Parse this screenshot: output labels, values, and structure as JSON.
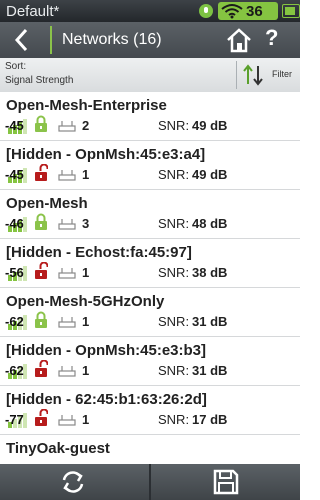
{
  "status": {
    "title": "Default*",
    "signal_value": "36"
  },
  "header": {
    "title": "Networks (16)"
  },
  "sort": {
    "label": "Sort:",
    "value": "Signal Strength",
    "filter_label": "Filter"
  },
  "snr_label": "SNR:",
  "networks": [
    {
      "ssid": "Open-Mesh-Enterprise",
      "rssi": "-45",
      "rssi_level": 0.75,
      "locked": true,
      "bssid_count": "2",
      "snr": "49 dB"
    },
    {
      "ssid": "[Hidden - OpnMsh:45:e3:a4]",
      "rssi": "-45",
      "rssi_level": 0.75,
      "locked": false,
      "bssid_count": "1",
      "snr": "49 dB"
    },
    {
      "ssid": "Open-Mesh",
      "rssi": "-46",
      "rssi_level": 0.75,
      "locked": true,
      "bssid_count": "3",
      "snr": "48 dB"
    },
    {
      "ssid": "[Hidden - Echost:fa:45:97]",
      "rssi": "-56",
      "rssi_level": 0.5,
      "locked": false,
      "bssid_count": "1",
      "snr": "38 dB"
    },
    {
      "ssid": "Open-Mesh-5GHzOnly",
      "rssi": "-62",
      "rssi_level": 0.5,
      "locked": true,
      "bssid_count": "1",
      "snr": "31 dB"
    },
    {
      "ssid": "[Hidden - OpnMsh:45:e3:b3]",
      "rssi": "-62",
      "rssi_level": 0.5,
      "locked": false,
      "bssid_count": "1",
      "snr": "31 dB"
    },
    {
      "ssid": "[Hidden - 62:45:b1:63:26:2d]",
      "rssi": "-77",
      "rssi_level": 0.25,
      "locked": false,
      "bssid_count": "1",
      "snr": "17 dB"
    },
    {
      "ssid": "TinyOak-guest",
      "rssi": "",
      "rssi_level": 0,
      "locked": true,
      "bssid_count": "",
      "snr": ""
    }
  ],
  "colors": {
    "accent_green": "#85c441",
    "lock_open": "#8bc34a",
    "lock_closed": "#b71c1c"
  },
  "icons": {
    "back": "chevron-left-icon",
    "home": "home-icon",
    "help": "question-icon",
    "sort": "sort-arrows-icon",
    "refresh": "refresh-icon",
    "save": "floppy-disk-icon"
  }
}
